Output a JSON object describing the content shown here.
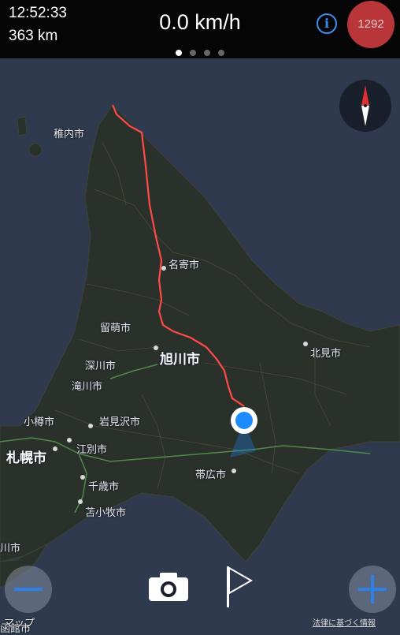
{
  "status": {
    "time": "12:52:33",
    "distance": "363 km",
    "speed": "0.0 km/h",
    "badge_count": "1292",
    "info_symbol": "i",
    "page_count": 4,
    "active_page": 1
  },
  "map": {
    "labels": [
      {
        "text": "稚内市"
      },
      {
        "text": "名寄市"
      },
      {
        "text": "留萌市"
      },
      {
        "text": "旭川市"
      },
      {
        "text": "深川市"
      },
      {
        "text": "北見市"
      },
      {
        "text": "滝川市"
      },
      {
        "text": "小樽市"
      },
      {
        "text": "岩見沢市"
      },
      {
        "text": "札幌市"
      },
      {
        "text": "江別市"
      },
      {
        "text": "帯広市"
      },
      {
        "text": "千歳市"
      },
      {
        "text": "苫小牧市"
      }
    ],
    "edge_label_left": "川市",
    "edge_label_bottom": "函館市",
    "credit": "マップ",
    "legal": "法律に基づく情報"
  },
  "colors": {
    "route": "#ff4a4a",
    "location": "#1e8cff",
    "accent": "#2e7fe6",
    "badge": "#b8363a"
  },
  "icons": {
    "info": "info-icon",
    "compass": "compass-icon",
    "zoom_out": "minus-icon",
    "zoom_in": "plus-icon",
    "camera": "camera-icon",
    "flag": "flag-icon"
  }
}
